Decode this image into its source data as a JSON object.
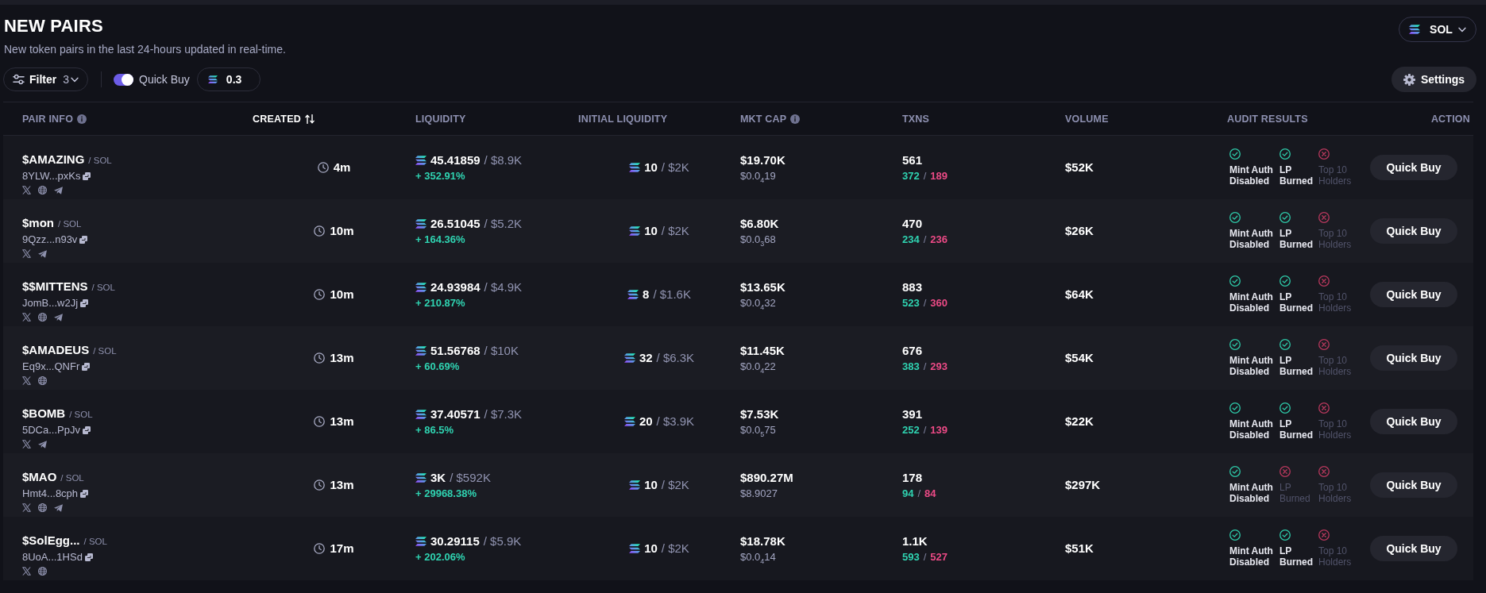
{
  "header": {
    "title": "NEW PAIRS",
    "subtitle": "New token pairs in the last 24-hours updated in real-time.",
    "chain": {
      "label": "SOL"
    }
  },
  "toolbar": {
    "filter": {
      "label": "Filter",
      "count": "3"
    },
    "quick_buy": {
      "label": "Quick Buy",
      "on": true
    },
    "amount": {
      "value": "0.3"
    },
    "settings": {
      "label": "Settings"
    }
  },
  "table": {
    "columns": [
      {
        "label": "PAIR INFO",
        "info": true,
        "sorted": false
      },
      {
        "label": "CREATED",
        "info": false,
        "sorted": true
      },
      {
        "label": "LIQUIDITY",
        "info": false,
        "sorted": false
      },
      {
        "label": "INITIAL LIQUIDITY",
        "info": false,
        "sorted": false
      },
      {
        "label": "MKT CAP",
        "info": true,
        "sorted": false
      },
      {
        "label": "TXNS",
        "info": false,
        "sorted": false
      },
      {
        "label": "VOLUME",
        "info": false,
        "sorted": false
      },
      {
        "label": "AUDIT RESULTS",
        "info": false,
        "sorted": false
      },
      {
        "label": "ACTION",
        "info": false,
        "sorted": false
      }
    ],
    "rows": [
      {
        "token": "$AMAZING",
        "quote": "/ SOL",
        "address": "8YLW...pxKs",
        "socials": [
          {
            "kind": "x"
          },
          {
            "kind": "web"
          },
          {
            "kind": "telegram"
          }
        ],
        "age": "4m",
        "liquidity": {
          "sol": "45.41859",
          "usd": "/ $8.9K",
          "change": "+ 352.91%"
        },
        "initial_liquidity": {
          "sol": "10",
          "usd": "/ $2K"
        },
        "market_cap": {
          "usd": "$19.70K",
          "price": "$0.0$_{4}$19"
        },
        "txns": {
          "total": "561",
          "buys": "372",
          "split": "/",
          "sells": "189"
        },
        "volume": "$52K",
        "audits": [
          {
            "label": "Mint Auth Disabled",
            "passed": true
          },
          {
            "label": "LP Burned",
            "passed": true
          },
          {
            "label": "Top 10 Holders",
            "passed": false
          }
        ],
        "action": "Quick Buy"
      },
      {
        "token": "$mon",
        "quote": "/ SOL",
        "address": "9Qzz...n93v",
        "socials": [
          {
            "kind": "x"
          },
          {
            "kind": "telegram"
          }
        ],
        "age": "10m",
        "liquidity": {
          "sol": "26.51045",
          "usd": "/ $5.2K",
          "change": "+ 164.36%"
        },
        "initial_liquidity": {
          "sol": "10",
          "usd": "/ $2K"
        },
        "market_cap": {
          "usd": "$6.80K",
          "price": "$0.0$_{3}$68"
        },
        "txns": {
          "total": "470",
          "buys": "234",
          "split": "/",
          "sells": "236"
        },
        "volume": "$26K",
        "audits": [
          {
            "label": "Mint Auth Disabled",
            "passed": true
          },
          {
            "label": "LP Burned",
            "passed": true
          },
          {
            "label": "Top 10 Holders",
            "passed": false
          }
        ],
        "action": "Quick Buy"
      },
      {
        "token": "$$MITTENS",
        "quote": "/ SOL",
        "address": "JomB...w2Jj",
        "socials": [
          {
            "kind": "x"
          },
          {
            "kind": "web"
          },
          {
            "kind": "telegram"
          }
        ],
        "age": "10m",
        "liquidity": {
          "sol": "24.93984",
          "usd": "/ $4.9K",
          "change": "+ 210.87%"
        },
        "initial_liquidity": {
          "sol": "8",
          "usd": "/ $1.6K"
        },
        "market_cap": {
          "usd": "$13.65K",
          "price": "$0.0$_{4}$32"
        },
        "txns": {
          "total": "883",
          "buys": "523",
          "split": "/",
          "sells": "360"
        },
        "volume": "$64K",
        "audits": [
          {
            "label": "Mint Auth Disabled",
            "passed": true
          },
          {
            "label": "LP Burned",
            "passed": true
          },
          {
            "label": "Top 10 Holders",
            "passed": false
          }
        ],
        "action": "Quick Buy"
      },
      {
        "token": "$AMADEUS",
        "quote": "/ SOL",
        "address": "Eq9x...QNFr",
        "socials": [
          {
            "kind": "x"
          },
          {
            "kind": "web"
          }
        ],
        "age": "13m",
        "liquidity": {
          "sol": "51.56768",
          "usd": "/ $10K",
          "change": "+ 60.69%"
        },
        "initial_liquidity": {
          "sol": "32",
          "usd": "/ $6.3K"
        },
        "market_cap": {
          "usd": "$11.45K",
          "price": "$0.0$_{4}$22"
        },
        "txns": {
          "total": "676",
          "buys": "383",
          "split": "/",
          "sells": "293"
        },
        "volume": "$54K",
        "audits": [
          {
            "label": "Mint Auth Disabled",
            "passed": true
          },
          {
            "label": "LP Burned",
            "passed": true
          },
          {
            "label": "Top 10 Holders",
            "passed": false
          }
        ],
        "action": "Quick Buy"
      },
      {
        "token": "$BOMB",
        "quote": "/ SOL",
        "address": "5DCa...PpJv",
        "socials": [
          {
            "kind": "x"
          },
          {
            "kind": "telegram"
          }
        ],
        "age": "13m",
        "liquidity": {
          "sol": "37.40571",
          "usd": "/ $7.3K",
          "change": "+ 86.5%"
        },
        "initial_liquidity": {
          "sol": "20",
          "usd": "/ $3.9K"
        },
        "market_cap": {
          "usd": "$7.53K",
          "price": "$0.0$_{5}$75"
        },
        "txns": {
          "total": "391",
          "buys": "252",
          "split": "/",
          "sells": "139"
        },
        "volume": "$22K",
        "audits": [
          {
            "label": "Mint Auth Disabled",
            "passed": true
          },
          {
            "label": "LP Burned",
            "passed": true
          },
          {
            "label": "Top 10 Holders",
            "passed": false
          }
        ],
        "action": "Quick Buy"
      },
      {
        "token": "$MAO",
        "quote": "/ SOL",
        "address": "Hmt4...8cph",
        "socials": [
          {
            "kind": "x"
          },
          {
            "kind": "web"
          },
          {
            "kind": "telegram"
          }
        ],
        "age": "13m",
        "liquidity": {
          "sol": "3K",
          "usd": "/ $592K",
          "change": "+ 29968.38%"
        },
        "initial_liquidity": {
          "sol": "10",
          "usd": "/ $2K"
        },
        "market_cap": {
          "usd": "$890.27M",
          "price": "$8.9027"
        },
        "txns": {
          "total": "178",
          "buys": "94",
          "split": "/",
          "sells": "84"
        },
        "volume": "$297K",
        "audits": [
          {
            "label": "Mint Auth Disabled",
            "passed": true
          },
          {
            "label": "LP Burned",
            "passed": false
          },
          {
            "label": "Top 10 Holders",
            "passed": false
          }
        ],
        "action": "Quick Buy"
      },
      {
        "token": "$SolEgg...",
        "quote": "/ SOL",
        "address": "8UoA...1HSd",
        "socials": [
          {
            "kind": "x"
          },
          {
            "kind": "web"
          }
        ],
        "age": "17m",
        "liquidity": {
          "sol": "30.29115",
          "usd": "/ $5.9K",
          "change": "+ 202.06%"
        },
        "initial_liquidity": {
          "sol": "10",
          "usd": "/ $2K"
        },
        "market_cap": {
          "usd": "$18.78K",
          "price": "$0.0$_{4}$14"
        },
        "txns": {
          "total": "1.1K",
          "buys": "593",
          "split": "/",
          "sells": "527"
        },
        "volume": "$51K",
        "audits": [
          {
            "label": "Mint Auth Disabled",
            "passed": true
          },
          {
            "label": "LP Burned",
            "passed": true
          },
          {
            "label": "Top 10 Holders",
            "passed": false
          }
        ],
        "action": "Quick Buy"
      }
    ]
  }
}
